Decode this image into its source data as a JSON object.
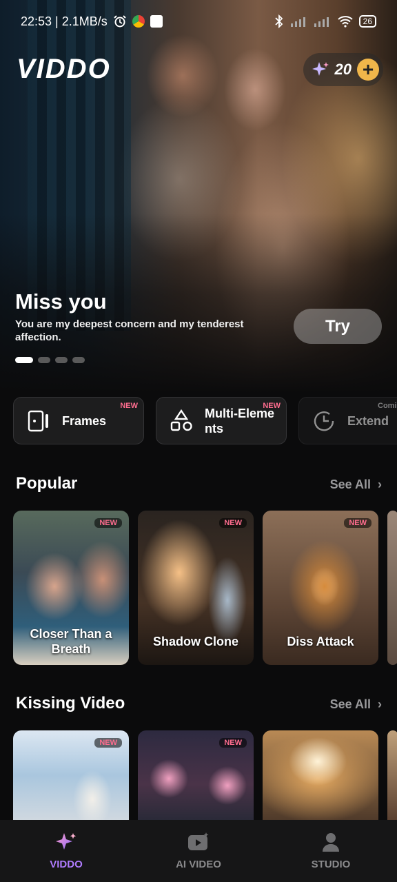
{
  "status_bar": {
    "time_speed": "22:53 | 2.1MB/s",
    "battery": "26"
  },
  "app": {
    "logo": "VIDDO",
    "credits": "20",
    "plus_icon": "plus-icon"
  },
  "hero": {
    "title": "Miss you",
    "subtitle": "You are my deepest concern and my tenderest affection.",
    "try_label": "Try",
    "carousel_active_index": 0,
    "carousel_count": 4
  },
  "features": [
    {
      "label": "Frames",
      "badge": "NEW"
    },
    {
      "label": "Multi-Elements",
      "label_line1": "Multi-Eleme",
      "label_line2": "nts",
      "badge": "NEW"
    },
    {
      "label": "Extend",
      "badge": "Comi"
    }
  ],
  "popular": {
    "title": "Popular",
    "see_all": "See All",
    "cards": [
      {
        "caption_line1": "Closer Than a",
        "caption_line2": "Breath",
        "badge": "NEW"
      },
      {
        "caption_line1": "Shadow Clone",
        "caption_line2": "",
        "badge": "NEW"
      },
      {
        "caption_line1": "Diss Attack",
        "caption_line2": "",
        "badge": "NEW"
      }
    ]
  },
  "kissing": {
    "title": "Kissing Video",
    "see_all": "See All",
    "cards": [
      {
        "badge": "NEW"
      },
      {
        "badge": "NEW"
      },
      {
        "badge": ""
      }
    ]
  },
  "nav": [
    {
      "label": "VIDDO",
      "icon": "sparkle-icon",
      "active": true
    },
    {
      "label": "AI VIDEO",
      "icon": "video-icon",
      "active": false
    },
    {
      "label": "STUDIO",
      "icon": "user-icon",
      "active": false
    }
  ],
  "colors": {
    "accent": "#b07cff",
    "badge": "#ff6d8f",
    "credit_button": "#f0b64a"
  }
}
